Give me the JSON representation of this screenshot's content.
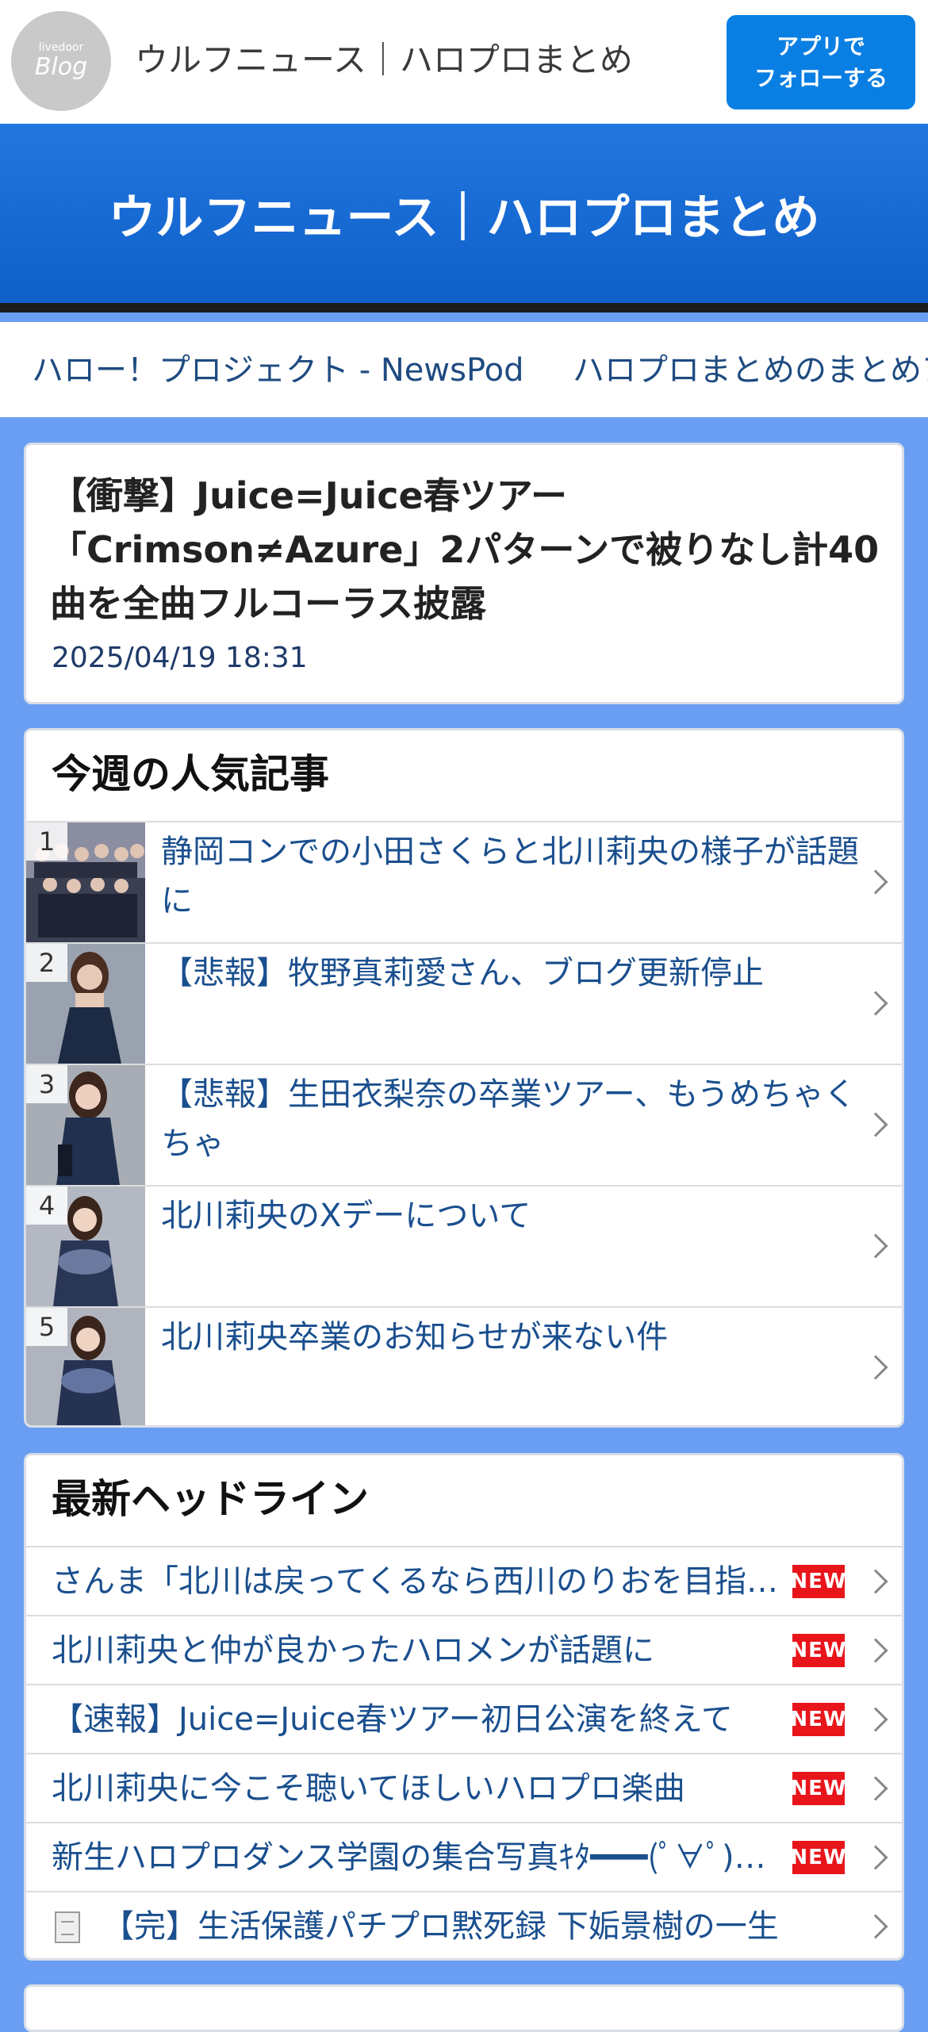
{
  "topbar": {
    "logo_small": "livedoor",
    "logo_big": "Blog",
    "site_name": "ウルフニュース｜ハロプロまとめ",
    "follow_line1": "アプリで",
    "follow_line2": "フォローする"
  },
  "hero": {
    "title": "ウルフニュース｜ハロプロまとめ"
  },
  "nav": {
    "items": [
      {
        "label": "ハロー！プロジェクト - NewsPod"
      },
      {
        "label": "ハロプロまとめのまとめア"
      }
    ]
  },
  "article": {
    "title": "【衝撃】Juice=Juice春ツアー「Crimson≠Azure」2パターンで被りなし計40曲を全曲フルコーラス披露",
    "date": "2025/04/19 18:31"
  },
  "popular": {
    "title": "今週の人気記事",
    "items": [
      {
        "rank": "1",
        "text": "静岡コンでの小田さくらと北川莉央の様子が話題に"
      },
      {
        "rank": "2",
        "text": "【悲報】牧野真莉愛さん、ブログ更新停止"
      },
      {
        "rank": "3",
        "text": "【悲報】生田衣梨奈の卒業ツアー、もうめちゃくちゃ"
      },
      {
        "rank": "4",
        "text": "北川莉央のXデーについて"
      },
      {
        "rank": "5",
        "text": "北川莉央卒業のお知らせが来ない件"
      }
    ]
  },
  "headlines": {
    "title": "最新ヘッドライン",
    "new_label": "NEW",
    "items": [
      {
        "text": "さんま「北川は戻ってくるなら西川のりおを目指せ」"
      },
      {
        "text": "北川莉央と仲が良かったハロメンが話題に"
      },
      {
        "text": "【速報】Juice=Juice春ツアー初日公演を終えて"
      },
      {
        "text": "北川莉央に今こそ聴いてほしいハロプロ楽曲"
      },
      {
        "text": "新生ハロプロダンス学園の集合写真ｷﾀ━━━(ﾟ∀ﾟ)━━━!!"
      },
      {
        "text": "【完】生活保護パチプロ黙死録 下姤景樹の一生"
      }
    ]
  },
  "colors": {
    "page_bg": "#6a9ef2",
    "hero_blue": "#1a6ad6",
    "follow_blue": "#0a7fe3",
    "link_blue": "#1a4f8e",
    "new_red": "#e8151b"
  }
}
